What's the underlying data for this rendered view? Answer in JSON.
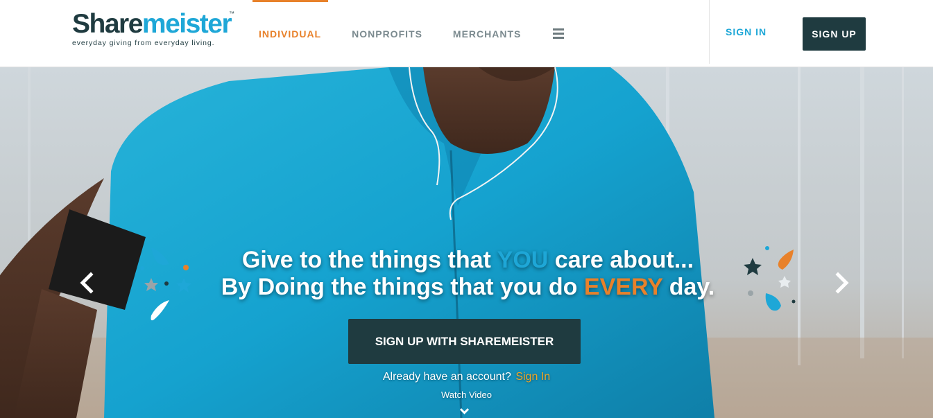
{
  "brand": {
    "name_part1": "S",
    "name_part2": "h",
    "name_part3": "are",
    "name_part4": "meister",
    "trademark": "™",
    "tagline": "everyday giving from everyday living."
  },
  "nav": {
    "items": [
      {
        "label": "INDIVIDUAL",
        "active": true
      },
      {
        "label": "NONPROFITS",
        "active": false
      },
      {
        "label": "MERCHANTS",
        "active": false
      }
    ],
    "menu_icon": "hamburger-icon"
  },
  "auth": {
    "signin_label": "SIGN IN",
    "signup_label": "SIGN UP"
  },
  "hero": {
    "line1_pre": "Give to the things that ",
    "line1_highlight": "YOU",
    "line1_post": " care about...",
    "line2_pre": "By Doing the things that you do ",
    "line2_highlight": "EVERY",
    "line2_post": " day.",
    "cta_label": "SIGN UP WITH SHAREMEISTER",
    "account_prompt": "Already have an account?",
    "account_signin": "Sign In",
    "watch_video": "Watch Video",
    "prev_icon": "chevron-left-icon",
    "next_icon": "chevron-right-icon"
  },
  "colors": {
    "brand_dark": "#1f3b40",
    "brand_blue": "#1ea7d7",
    "brand_orange": "#e8812a",
    "signin_yellow": "#f2a623"
  }
}
